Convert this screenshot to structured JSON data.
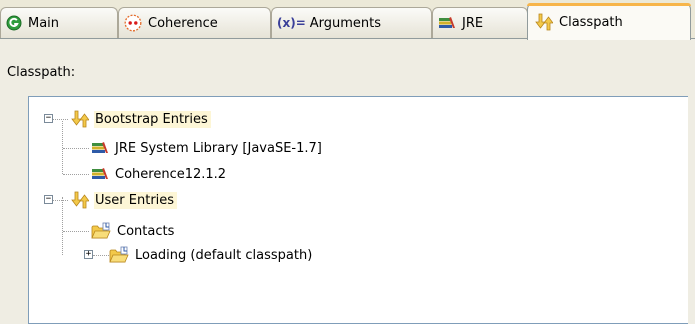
{
  "tabs": [
    {
      "label": "Main",
      "icon": "main-tab-icon"
    },
    {
      "label": "Coherence",
      "icon": "coherence-icon"
    },
    {
      "label": "Arguments",
      "icon": "arguments-icon",
      "prefix": "(x)="
    },
    {
      "label": "JRE",
      "icon": "jre-library-icon"
    },
    {
      "label": "Classpath",
      "icon": "classpath-icon",
      "active": true
    }
  ],
  "classpath": {
    "section_label": "Classpath:",
    "tree": [
      {
        "label": "Bootstrap Entries",
        "icon": "classpath-entries-icon",
        "expanded": true,
        "highlighted": true
      },
      {
        "label": "JRE System Library [JavaSE-1.7]",
        "icon": "library-icon"
      },
      {
        "label": "Coherence12.1.2",
        "icon": "library-icon"
      },
      {
        "label": "User Entries",
        "icon": "classpath-entries-icon",
        "expanded": true,
        "highlighted": true
      },
      {
        "label": "Contacts",
        "icon": "project-folder-icon"
      },
      {
        "label": "Loading (default classpath)",
        "icon": "project-folder-icon",
        "expanded": false
      }
    ]
  },
  "colors": {
    "active_tab_accent": "#f7b54a",
    "tree_border": "#7f9db9",
    "highlight": "#fdf6d6",
    "panel_background": "#efede3"
  }
}
